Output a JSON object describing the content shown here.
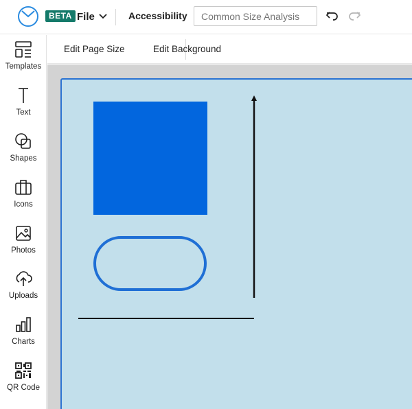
{
  "header": {
    "beta_badge": "BETA",
    "file_menu_label": "File",
    "accessibility_label": "Accessibility",
    "document_title_placeholder": "Common Size Analysis"
  },
  "sidebar": {
    "items": [
      {
        "label": "Templates",
        "icon": "templates-icon"
      },
      {
        "label": "Text",
        "icon": "text-icon"
      },
      {
        "label": "Shapes",
        "icon": "shapes-icon"
      },
      {
        "label": "Icons",
        "icon": "icons-icon"
      },
      {
        "label": "Photos",
        "icon": "photos-icon"
      },
      {
        "label": "Uploads",
        "icon": "uploads-icon"
      },
      {
        "label": "Charts",
        "icon": "charts-icon"
      },
      {
        "label": "QR Code",
        "icon": "qr-code-icon"
      }
    ]
  },
  "toolbar": {
    "edit_page_size_label": "Edit Page Size",
    "edit_background_label": "Edit Background"
  },
  "colors": {
    "brand_badge": "#147a6a",
    "page_background": "#c2dfeb",
    "square_fill": "#0266de",
    "pill_stroke": "#1f6fd5",
    "selection_border": "#2b73d2"
  }
}
